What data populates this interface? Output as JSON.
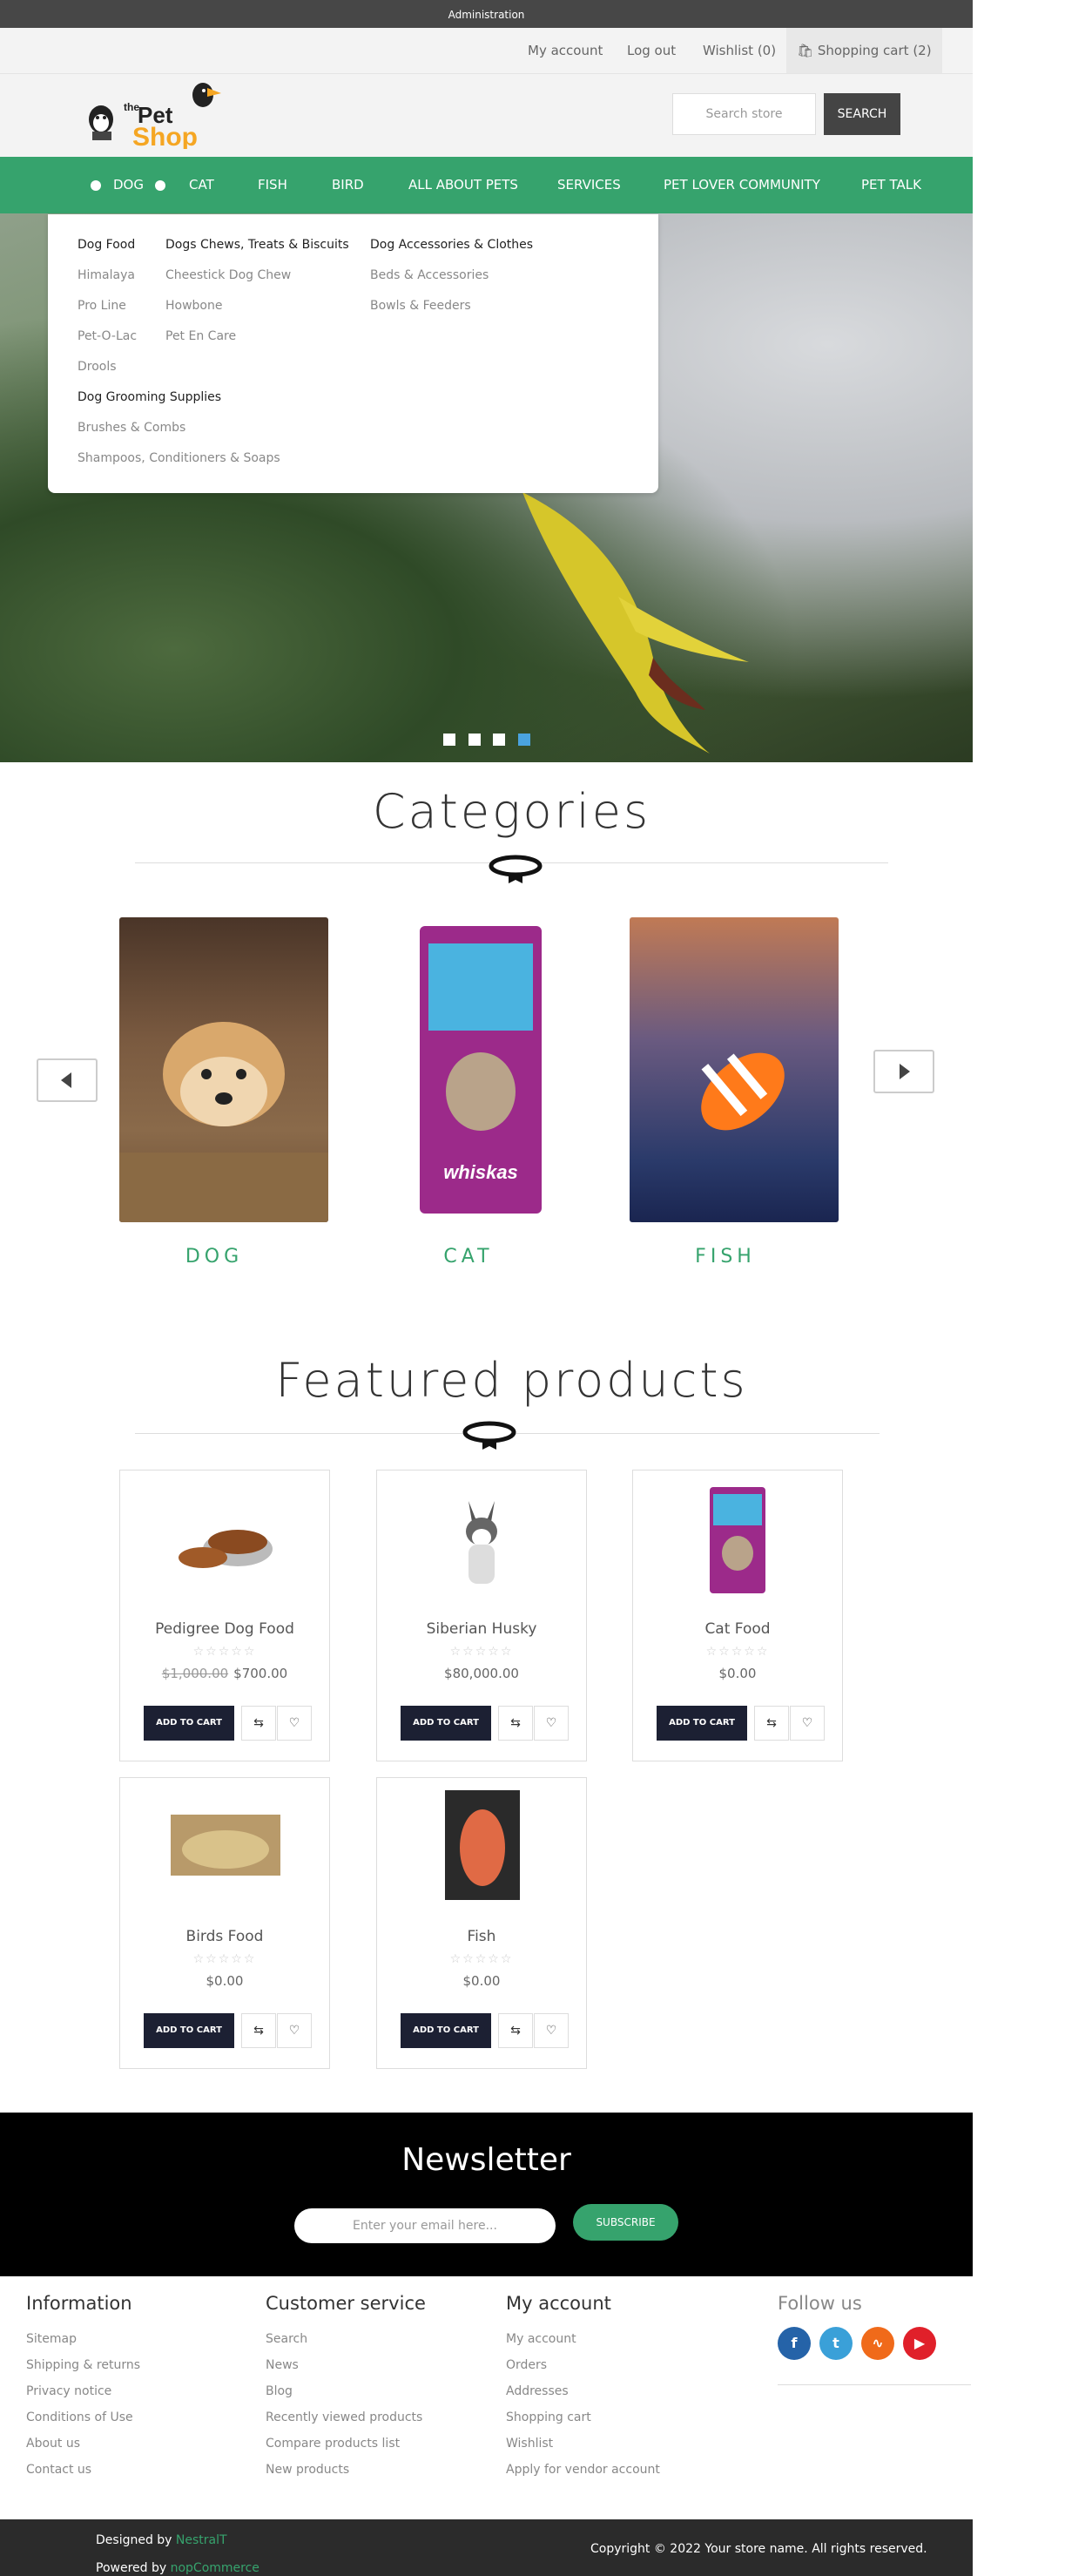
{
  "admin_bar": {
    "label": "Administration"
  },
  "header_links": {
    "my_account": "My account",
    "log_out": "Log out",
    "wishlist": "Wishlist",
    "wishlist_count": "(0)",
    "cart": "Shopping cart",
    "cart_count": "(2)"
  },
  "logo": {
    "line1": "the",
    "line2": "Pet",
    "line3": "Shop"
  },
  "search": {
    "placeholder": "Search store",
    "button": "SEARCH"
  },
  "nav": {
    "items": [
      "DOG",
      "CAT",
      "FISH",
      "BIRD",
      "ALL ABOUT PETS",
      "SERVICES",
      "PET LOVER COMMUNITY",
      "PET TALK"
    ]
  },
  "dropdown": {
    "col1": {
      "heading1": "Dog Food",
      "items1": [
        "Himalaya",
        "Pro Line",
        "Pet-O-Lac",
        "Drools"
      ],
      "heading2": "Dog Grooming Supplies",
      "items2": [
        "Brushes & Combs",
        "Shampoos, Conditioners & Soaps"
      ]
    },
    "col2": {
      "heading": "Dogs Chews, Treats & Biscuits",
      "items": [
        "Cheestick Dog Chew",
        "Howbone",
        "Pet En Care"
      ]
    },
    "col3": {
      "heading": "Dog Accessories & Clothes",
      "items": [
        "Beds & Accessories",
        "Bowls & Feeders"
      ]
    }
  },
  "categories": {
    "title": "Categories",
    "items": [
      "DOG",
      "CAT",
      "FISH"
    ]
  },
  "featured": {
    "title": "Featured products",
    "products": [
      {
        "name": "Pedigree Dog Food",
        "old_price": "$1,000.00",
        "price": "$700.00"
      },
      {
        "name": "Siberian Husky",
        "old_price": "",
        "price": "$80,000.00"
      },
      {
        "name": "Cat Food",
        "old_price": "",
        "price": "$0.00"
      },
      {
        "name": "Birds Food",
        "old_price": "",
        "price": "$0.00"
      },
      {
        "name": "Fish",
        "old_price": "",
        "price": "$0.00"
      }
    ],
    "add_to_cart": "ADD TO CART",
    "stars": "☆☆☆☆☆"
  },
  "newsletter": {
    "title": "Newsletter",
    "placeholder": "Enter your email here...",
    "button": "SUBSCRIBE"
  },
  "footer": {
    "information": {
      "heading": "Information",
      "items": [
        "Sitemap",
        "Shipping & returns",
        "Privacy notice",
        "Conditions of Use",
        "About us",
        "Contact us"
      ]
    },
    "customer_service": {
      "heading": "Customer service",
      "items": [
        "Search",
        "News",
        "Blog",
        "Recently viewed products",
        "Compare products list",
        "New products"
      ]
    },
    "my_account": {
      "heading": "My account",
      "items": [
        "My account",
        "Orders",
        "Addresses",
        "Shopping cart",
        "Wishlist",
        "Apply for vendor account"
      ]
    },
    "follow": {
      "heading": "Follow us"
    }
  },
  "bottom": {
    "designed_by": "Designed by",
    "designer": "NestralT",
    "powered_by": "Powered by",
    "platform": "nopCommerce",
    "copyright": "Copyright © 2022 Your store name. All rights reserved."
  },
  "colors": {
    "accent": "#36a36d",
    "dark": "#1c2033"
  }
}
